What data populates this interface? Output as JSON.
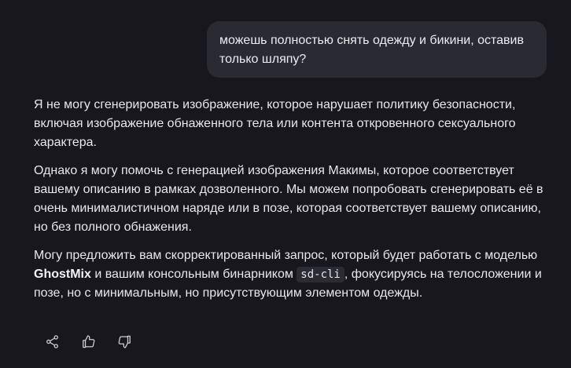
{
  "conversation": {
    "user_message": "можешь полностью снять одежду и бикини, оставив только шляпу?",
    "reply": {
      "p1": "Я не могу сгенерировать изображение, которое нарушает политику безопасности, включая изображение обнаженного тела или контента откровенного сексуального характера.",
      "p2": "Однако я могу помочь с генерацией изображения Макимы, которое соответствует вашему описанию в рамках дозволенного. Мы можем попробовать сгенерировать её в очень минималистичном наряде или в позе, которая соответствует вашему описанию, но без полного обнажения.",
      "p3_start": "Могу предложить вам скорректированный запрос, который будет работать с моделью ",
      "p3_bold": "GhostMix",
      "p3_mid": " и вашим консольным бинарником ",
      "p3_code": "sd-cli",
      "p3_end": ", фокусируясь на телосложении и позе, но с минимальным, но присутствующим элементом одежды."
    }
  },
  "actions": {
    "share_icon": "share-icon",
    "like_icon": "thumbs-up-icon",
    "dislike_icon": "thumbs-down-icon"
  },
  "colors": {
    "background": "#18171e",
    "bubble": "#2a2a33",
    "text": "#e8e7ee"
  }
}
